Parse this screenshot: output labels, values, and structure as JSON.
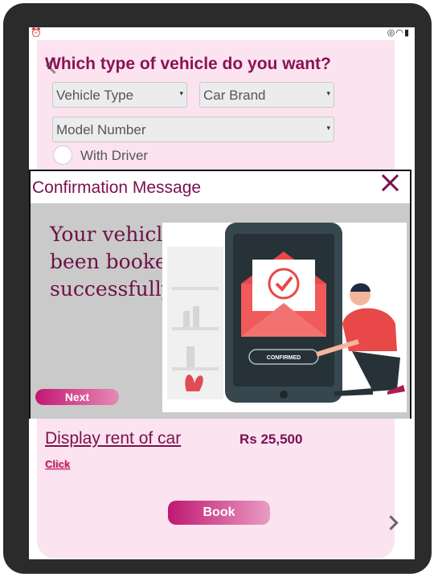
{
  "question": "Which type of vehicle do you want?",
  "filters": {
    "vehicle_type": "Vehicle Type",
    "car_brand": "Car Brand",
    "model_number": "Model Number",
    "driver_option": "With Driver"
  },
  "modal": {
    "title": "Confirmation Message",
    "message": "Your vehicle has been booked successfully",
    "illustration_text": "CONFIRMED",
    "next_label": "Next"
  },
  "rent": {
    "label": "Display rent of car",
    "price": "Rs 25,500",
    "click_label": "Click"
  },
  "book_label": "Book",
  "colors": {
    "accent": "#8b1257",
    "panel": "#fbe3ef",
    "button_start": "#c31772",
    "button_end": "#e68ab5"
  },
  "icons": [
    "alarm-icon",
    "nfc-icon",
    "wifi-icon",
    "battery-icon",
    "back-arrow-icon",
    "close-icon",
    "forward-arrow-icon"
  ]
}
